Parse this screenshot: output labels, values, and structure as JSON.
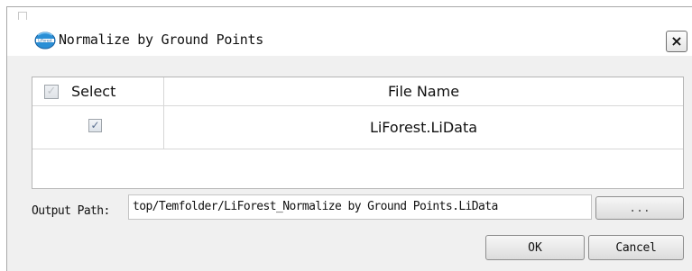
{
  "window": {
    "title": "Normalize by Ground Points",
    "logo_icon": "liforest-logo-icon",
    "close_label": "×"
  },
  "table": {
    "columns": [
      "Select",
      "File Name"
    ],
    "select_all_checked": true,
    "rows": [
      {
        "checked": true,
        "file_name": "LiForest.LiData"
      }
    ]
  },
  "output": {
    "label": "Output Path:",
    "value": "top/Temfolder/LiForest_Normalize by Ground Points.LiData",
    "browse_label": "..."
  },
  "buttons": {
    "ok": "OK",
    "cancel": "Cancel"
  }
}
